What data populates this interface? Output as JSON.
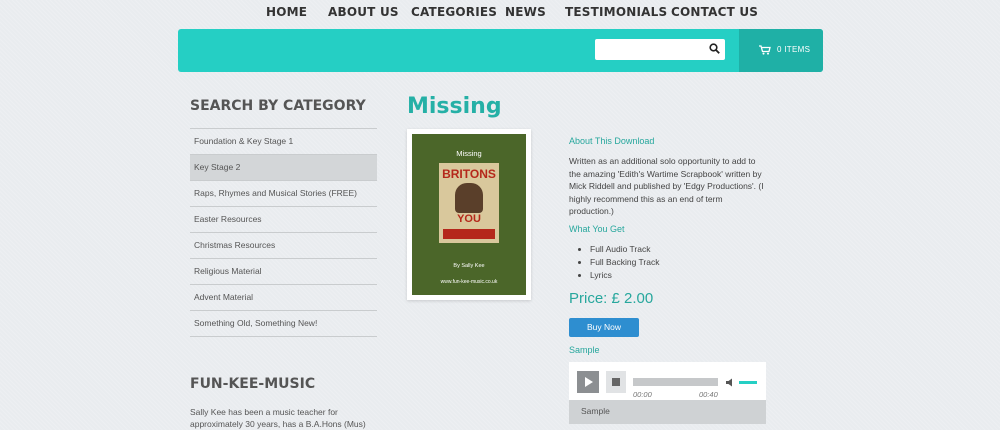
{
  "nav": {
    "items": [
      "HOME",
      "ABOUT US",
      "CATEGORIES",
      "NEWS",
      "TESTIMONIALS",
      "CONTACT US"
    ]
  },
  "header": {
    "search_placeholder": "",
    "cart_label": "0 ITEMS",
    "bar_color": "#25cfc4"
  },
  "sidebar": {
    "heading": "SEARCH BY CATEGORY",
    "categories": [
      "Foundation & Key Stage 1",
      "Key Stage 2",
      "Raps, Rhymes and Musical Stories (FREE)",
      "Easter Resources",
      "Christmas Resources",
      "Religious Material",
      "Advent Material",
      "Something Old, Something New!"
    ],
    "active_index": 1,
    "about_heading": "FUN-KEE-MUSIC",
    "about_text": "Sally Kee has been a music teacher for approximately 30 years, has a B.A.Hons (Mus)"
  },
  "product": {
    "title": "Missing",
    "cover": {
      "title": "Missing",
      "poster_word": "BRITONS",
      "poster_you": "YOU",
      "author": "By Sally Kee",
      "url": "www.fun-kee-music.co.uk"
    },
    "about_heading": "About This Download",
    "description": "Written as an additional solo opportunity to add to the amazing 'Edith's Wartime Scrapbook' written by Mick Riddell and published by 'Edgy Productions'. (I highly recommend this as an end of term production.)",
    "what_heading": "What You Get",
    "what_items": [
      "Full Audio Track",
      "Full Backing Track",
      "Lyrics"
    ],
    "price": "Price: £ 2.00",
    "buy_label": "Buy Now",
    "sample_heading": "Sample"
  },
  "player": {
    "current_time": "00:00",
    "duration": "00:40",
    "track_label": "Sample"
  },
  "colors": {
    "accent": "#25b0a6",
    "buy": "#2e8ed0"
  }
}
